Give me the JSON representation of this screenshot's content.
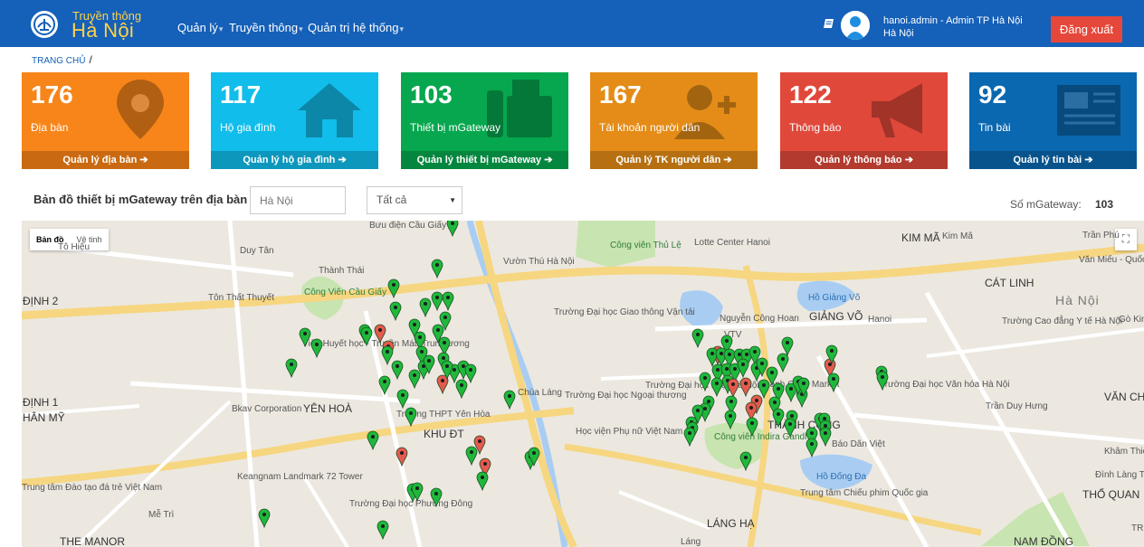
{
  "header": {
    "brand_small": "Truyền thông",
    "brand_big": "Hà Nội",
    "nav": [
      "Quản lý",
      "Truyền thông",
      "Quản trị hệ thống"
    ],
    "user_name": "hanoi.admin - Admin TP Hà Nội",
    "user_city": "Hà Nội",
    "logout_label": "Đăng xuất"
  },
  "breadcrumb": {
    "home": "TRANG CHỦ",
    "separator": "/"
  },
  "tiles": [
    {
      "value": "176",
      "label": "Địa bàn",
      "link": "Quản lý địa bàn",
      "color": "#f7851a",
      "foot_color": "#c96a12",
      "icon": "map-pin-icon"
    },
    {
      "value": "117",
      "label": "Hộ gia đình",
      "link": "Quản lý hộ gia đình",
      "color": "#11bdea",
      "foot_color": "#0e97bc",
      "icon": "house-icon"
    },
    {
      "value": "103",
      "label": "Thiết bị mGateway",
      "link": "Quản lý thiết bị mGateway",
      "color": "#06a74f",
      "foot_color": "#05863f",
      "icon": "fax-icon"
    },
    {
      "value": "167",
      "label": "Tài khoản người dân",
      "link": "Quản lý TK người dân",
      "color": "#e48c17",
      "foot_color": "#b67012",
      "icon": "user-plus-icon"
    },
    {
      "value": "122",
      "label": "Thông báo",
      "link": "Quản lý thông báo",
      "color": "#e0483a",
      "foot_color": "#b33a2e",
      "icon": "megaphone-icon"
    },
    {
      "value": "92",
      "label": "Tin bài",
      "link": "Quản lý tin bài",
      "color": "#0a68b0",
      "foot_color": "#08538c",
      "icon": "newspaper-icon"
    }
  ],
  "map_section": {
    "title": "Bản đồ thiết bị mGateway trên địa bàn",
    "search_placeholder": "Hà Nội",
    "select_value": "Tất cả",
    "count_label": "Số mGateway:",
    "count_value": "103"
  },
  "map": {
    "type_controls": [
      "Bản đồ",
      "Vệ tinh"
    ],
    "labels": [
      "Bưu điện Cầu Giấy",
      "Vườn Thú Hà Nội",
      "Công viên Thủ Lệ",
      "Lotte Center Hanoi",
      "KIM MÃ",
      "Kim Mã",
      "Văn Miếu - Quốc Tử Giám",
      "CÁT LINH",
      "Hà Nội",
      "Gò Kim Châu",
      "Trường Cao đẳng Y tế Hà Nội",
      "Hồ Giảng Võ",
      "GIẢNG VÕ",
      "Hanoi",
      "Nguyễn Công Hoan",
      "VTV",
      "Trường Đại học Giao thông Vận tải",
      "Công Viên Cầu Giấy",
      "Viện Huyết học - Truyền Máu Trung ương",
      "Tôn Thất Thuyết",
      "ĐỊNH 2",
      "ĐỊNH 1",
      "HÂN MỸ",
      "Bkav Corporation",
      "YÊN HOÀ",
      "Trường THPT Yên Hòa",
      "KHU ĐT",
      "Trường Đại học Ngoại thương",
      "Trường Đại học Luật Hà Nội",
      "Học viện Phụ nữ Việt Nam",
      "Thành Công Market",
      "THÀNH CÔNG",
      "Trường Đại học Văn hóa Hà Nội",
      "VĂN CH",
      "Báo Dân Việt",
      "Công viên Indira Gandhi",
      "Hồ Đống Đa",
      "Trung tâm Chiếu phim Quốc gia",
      "Khâm Thiên",
      "Đình Làng Th",
      "THỔ QUAN",
      "Keangnam Landmark 72 Tower",
      "Trường Đại học Phương Đông",
      "Trung tâm Đào tạo đá trẻ Việt Nam",
      "THE MANOR",
      "LÁNG HẠ",
      "NAM ĐỒNG",
      "TRU",
      "Duy Tân",
      "Thành Thái",
      "Tô Hiệu",
      "Chùa Láng",
      "Trần Phú",
      "Láng",
      "Mễ Trì",
      "Trần Duy Hưng"
    ],
    "marker_status": {
      "online": "#1fb83b",
      "offline": "#e55a4e"
    }
  }
}
